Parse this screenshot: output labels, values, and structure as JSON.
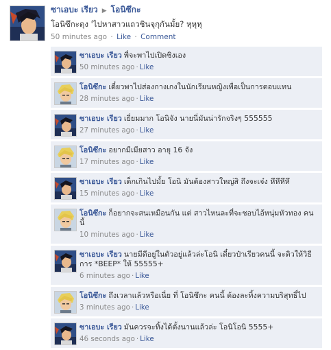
{
  "post": {
    "author": "ซาเอบะ เรียว",
    "recipient": "โอนิซึกะ",
    "text": "โอนิซึกะตุง 'ไปหาสาวแถวชินจุกุกันมั้ย? หุหุหุ",
    "time": "50 minutes ago",
    "like_label": "Like",
    "comment_label": "Comment",
    "separator": "·",
    "arrow": "▶"
  },
  "comments": [
    {
      "author": "ซาเอบะ เรียว",
      "avatar": "ryo",
      "text": "พี่จะพาไปเปิดซิงเอง",
      "time": "50 minutes ago",
      "like_label": "Like"
    },
    {
      "author": "โอนิซึกะ",
      "avatar": "onizuka",
      "text": "เดี๋ยวพาไปส่องกางเกงในนักเรียนหญิงเพื่อเป็นการตอบแทน",
      "time": "28 minutes ago",
      "like_label": "Like"
    },
    {
      "author": "ซาเอบะ เรียว",
      "avatar": "ryo",
      "text": "เยี่ยมมาก โอนิจัง นายนี่มันน่ารักจริงๆ 555555",
      "time": "27 minutes ago",
      "like_label": "Like"
    },
    {
      "author": "โอนิซึกะ",
      "avatar": "onizuka",
      "text": "อยากมีเมียสาว อายุ 16 จัง",
      "time": "17 minutes ago",
      "like_label": "Like"
    },
    {
      "author": "ซาเอบะ เรียว",
      "avatar": "ryo",
      "text": "เด็กเกินไปมั้ย โอนิ มันต้องสาวใหญ่สิ ถึงจะเจ๋ง หึหึหึหึ",
      "time": "15 minutes ago",
      "like_label": "Like"
    },
    {
      "author": "โอนิซึกะ",
      "avatar": "onizuka",
      "text": "ก็อยากจะสนเหมือนกัน แต่ สาวไหนละที่จะชอบไอ้หนุ่มหัวทอง คนนี้",
      "time": "10 minutes ago",
      "like_label": "Like"
    },
    {
      "author": "ซาเอบะ เรียว",
      "avatar": "ryo",
      "text": "นายมีดีอยู่ในตัวอยู่แล้วล่ะโอนิ เดี๋ยวป๋าเรียวคนนี้ จะติวให้วิธีการ *BEEP* ให้ 55555+",
      "time": "6 minutes ago",
      "like_label": "Like"
    },
    {
      "author": "โอนิซึกะ",
      "avatar": "onizuka",
      "text": "ถึงเวลาแล้วหรือเนี่ย ที่ โอนิซึกะ คนนี้ ต้องละทิ้งความบริสุทธิ์ไป",
      "time": "3 minutes ago",
      "like_label": "Like"
    },
    {
      "author": "ซาเอบะ เรียว",
      "avatar": "ryo",
      "text": "มันควรจะทิ้งได้ตั้งนานแล้วล่ะ โอนิโอนิ 5555+",
      "time": "46 seconds ago",
      "like_label": "Like"
    }
  ],
  "colors": {
    "link": "#3b5998",
    "comment_bg": "#eceff5",
    "meta": "#888888"
  }
}
